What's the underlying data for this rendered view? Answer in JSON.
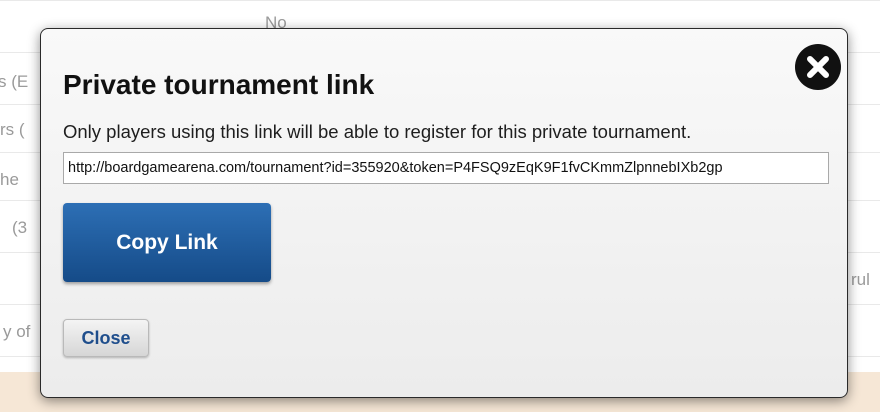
{
  "background": {
    "fragments": [
      {
        "text": "No"
      },
      {
        "text": "s (E"
      },
      {
        "text": "rs ("
      },
      {
        "text": "he"
      },
      {
        "text": "(3"
      },
      {
        "text": "rul"
      },
      {
        "text": "y of"
      }
    ]
  },
  "dialog": {
    "title": "Private tournament link",
    "description": "Only players using this link will be able to register for this private tournament.",
    "link_value": "http://boardgamearena.com/tournament?id=355920&token=P4FSQ9zEqK9F1fvCKmmZlpnnebIXb2gp",
    "copy_button_label": "Copy Link",
    "close_button_label": "Close",
    "close_icon": "close-circle-icon"
  },
  "colors": {
    "primary_button": "#1d5a9e",
    "close_button_text": "#1f4e8c",
    "modal_background": "#f2f2f2"
  }
}
